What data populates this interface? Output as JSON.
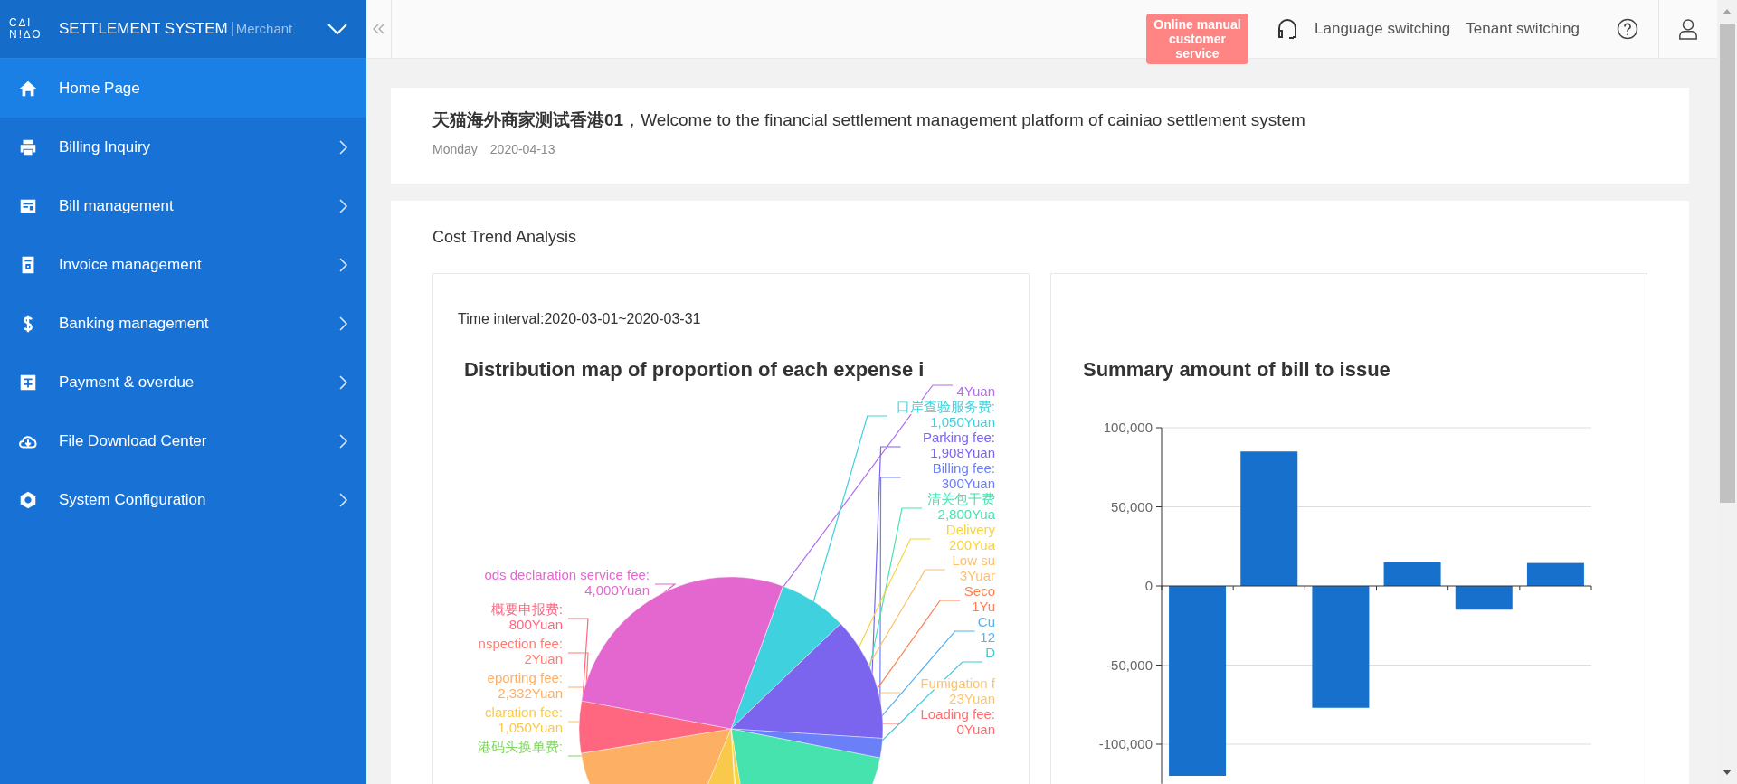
{
  "sidebar": {
    "logo_lines": [
      "C∆I",
      "N!∆O"
    ],
    "title": "SETTLEMENT SYSTEM",
    "subtitle": "Merchant",
    "items": [
      {
        "label": "Home Page",
        "selected": true,
        "has_submenu": false
      },
      {
        "label": "Billing Inquiry",
        "selected": false,
        "has_submenu": true
      },
      {
        "label": "Bill management",
        "selected": false,
        "has_submenu": true
      },
      {
        "label": "Invoice management",
        "selected": false,
        "has_submenu": true
      },
      {
        "label": "Banking management",
        "selected": false,
        "has_submenu": true
      },
      {
        "label": "Payment & overdue",
        "selected": false,
        "has_submenu": true
      },
      {
        "label": "File Download Center",
        "selected": false,
        "has_submenu": true
      },
      {
        "label": "System Configuration",
        "selected": false,
        "has_submenu": true
      }
    ]
  },
  "header": {
    "tooltip": "Online manual customer service",
    "links": [
      "Language switching",
      "Tenant switching"
    ]
  },
  "welcome": {
    "text": "**天猫海外商家测试香港01**，Welcome to the financial settlement management platform of cainiao settlement system",
    "weekday": "Monday",
    "date": "2020-04-13"
  },
  "cost_trend": {
    "title": "Cost Trend Analysis",
    "pie": {
      "time_interval": "Time interval:2020-03-01~2020-03-31",
      "title": "Distribution map of proportion of each expense i",
      "labels": [
        {
          "value": "4Yuan",
          "color": "#b36cf2"
        },
        {
          "name": "口岸查验服务费:",
          "value": "1,050Yuan",
          "color": "#3fd1de"
        },
        {
          "name": "Parking fee:",
          "value": "1,908Yuan",
          "color": "#7b65ee"
        },
        {
          "name": "Billing fee:",
          "value": "300Yuan",
          "color": "#6b80f8"
        },
        {
          "name": "清关包干费",
          "value": "2,800Yua",
          "color": "#46e3ae"
        },
        {
          "name": "Delivery",
          "value": "200Yua",
          "color": "#f7d43f"
        },
        {
          "name": "Low su",
          "value": "3Yuar",
          "color": "#fdbf6a"
        },
        {
          "name": "Seco",
          "value": "1Yu",
          "color": "#ff7f50"
        },
        {
          "name": "Cu",
          "value": "12",
          "color": "#5ab1ef"
        },
        {
          "name": "D",
          "color": "#3fc8e0"
        },
        {
          "name": "Fumigation f",
          "value": "23Yuan",
          "color": "#ffc46b"
        },
        {
          "name": "Loading fee:",
          "value": "0Yuan",
          "color": "#ff6e6e"
        },
        {
          "name": "ods declaration service fee:",
          "value": "4,000Yuan",
          "color": "#e467cf"
        },
        {
          "name": "概要申报费:",
          "value": "800Yuan",
          "color": "#ff6680"
        },
        {
          "name": "nspection fee:",
          "value": "2Yuan",
          "color": "#ff7d70"
        },
        {
          "name": "eporting fee:",
          "value": "2,332Yuan",
          "color": "#fdb063"
        },
        {
          "name": "claration fee:",
          "value": "1,050Yuan",
          "color": "#f8c94a"
        },
        {
          "name": "港码头换单费:",
          "color": "#7fd85e"
        }
      ]
    },
    "bar": {
      "chart_data": {
        "type": "bar",
        "title": "Summary amount of bill to issue",
        "ylim": [
          -125000,
          100000
        ],
        "grid": true,
        "yticks": [
          {
            "value": 100000,
            "label": "100,000"
          },
          {
            "value": 50000,
            "label": "50,000"
          },
          {
            "value": 0,
            "label": "0"
          },
          {
            "value": -50000,
            "label": "-50,000"
          },
          {
            "value": -100000,
            "label": "-100,000"
          }
        ],
        "series": [
          {
            "color": "#1670cc",
            "values": [
              -120000,
              85000,
              -77000,
              15000,
              -15000,
              14500
            ]
          }
        ]
      }
    }
  }
}
